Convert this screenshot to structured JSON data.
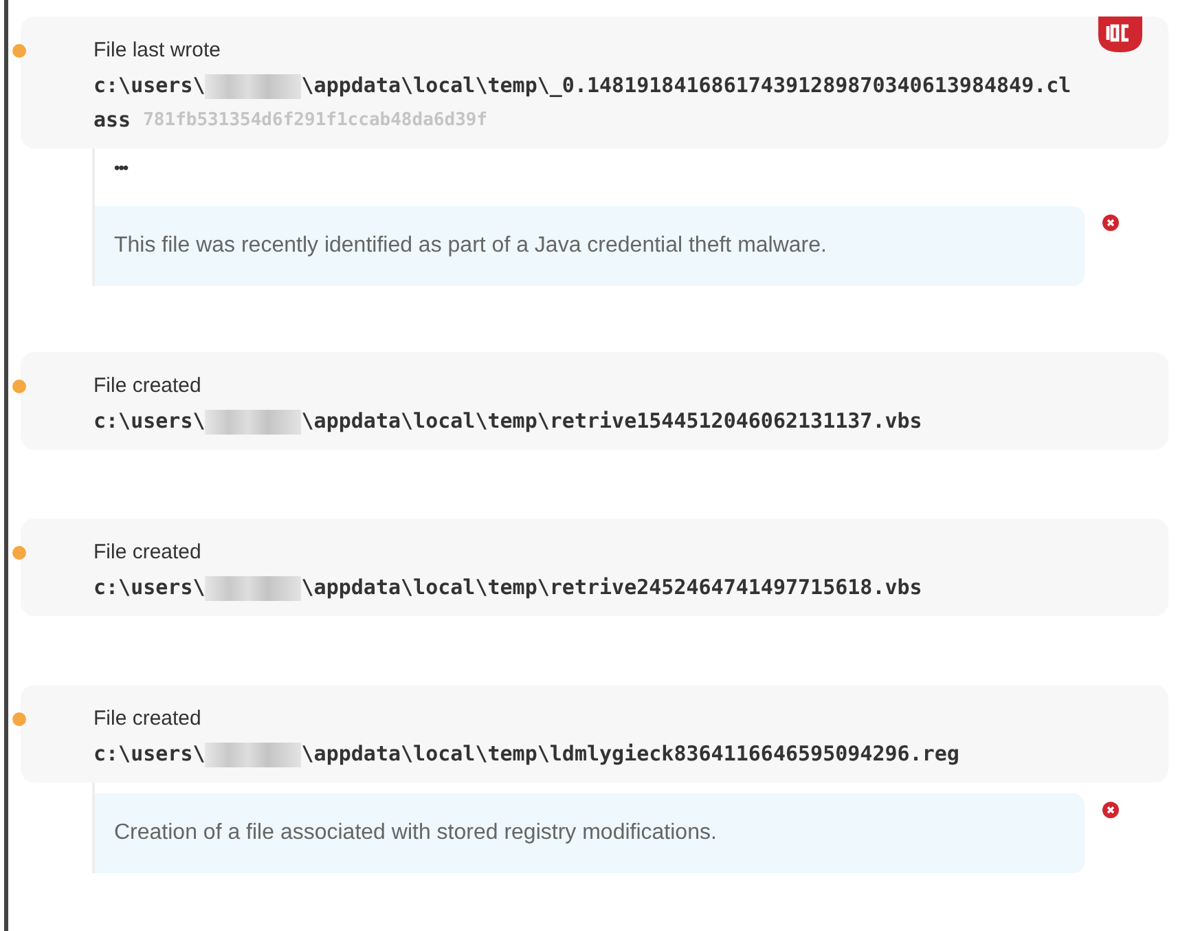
{
  "events": [
    {
      "title": "File last wrote",
      "path_start": "c:\\users\\",
      "username_redacted": true,
      "path_end": "\\appdata\\local\\temp\\_0.148191841686174391289870340613984849.class",
      "hash": "781fb531354d6f291f1ccab48da6d39f",
      "ioc": true,
      "more": "•••",
      "note": "This file was recently identified as part of a Java credential theft malware."
    },
    {
      "title": "File created",
      "path_start": "c:\\users\\",
      "username_redacted": true,
      "path_end": "\\appdata\\local\\temp\\retrive1544512046062131137.vbs"
    },
    {
      "title": "File created",
      "path_start": "c:\\users\\",
      "username_redacted": true,
      "path_end": "\\appdata\\local\\temp\\retrive2452464741497715618.vbs"
    },
    {
      "title": "File created",
      "path_start": "c:\\users\\",
      "username_redacted": true,
      "path_end": "\\appdata\\local\\temp\\ldmlygieck8364116646595094296.reg",
      "note": "Creation of a file associated with stored registry modifications."
    }
  ]
}
